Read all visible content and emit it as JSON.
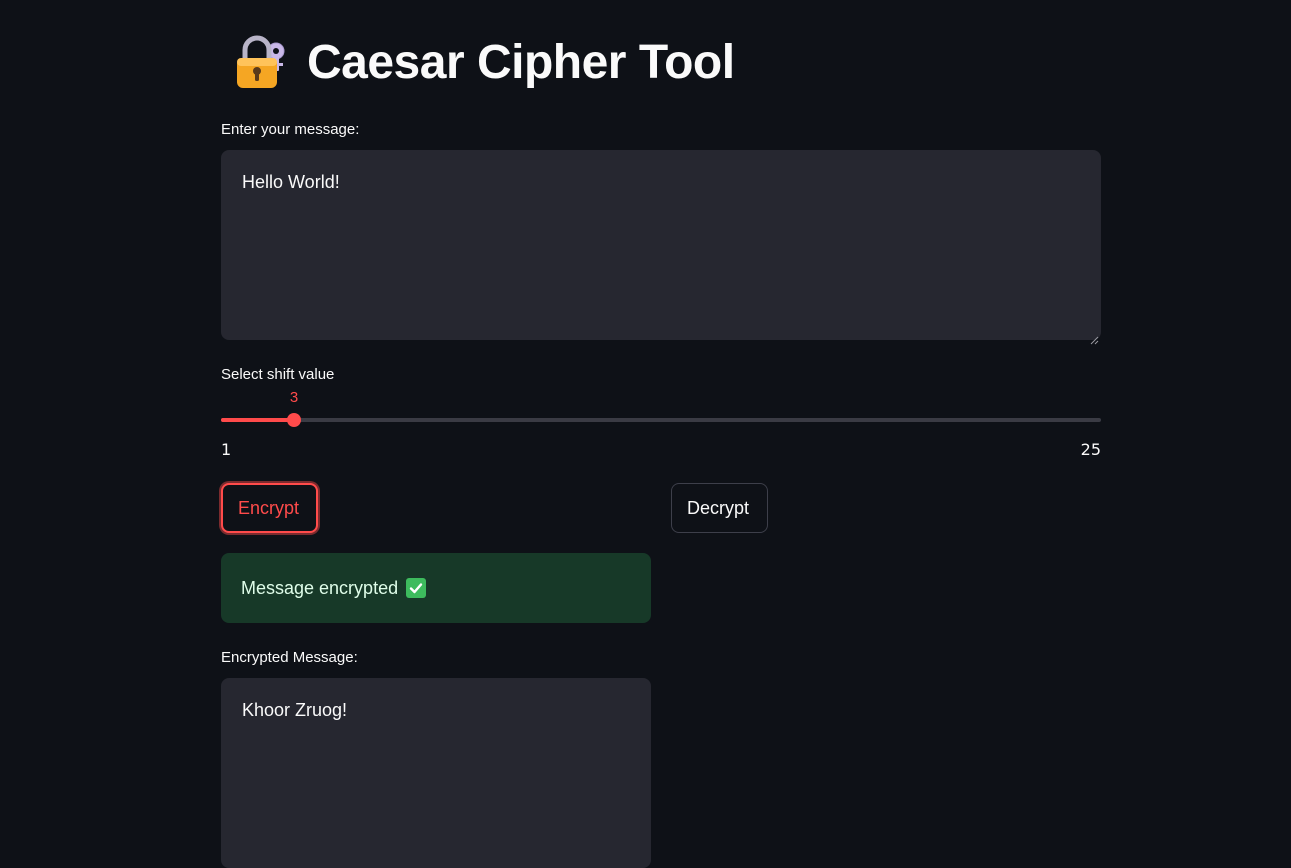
{
  "header": {
    "title": "Caesar Cipher Tool",
    "icon": "lock-with-key-icon"
  },
  "input": {
    "label": "Enter your message:",
    "value": "Hello World!"
  },
  "slider": {
    "label": "Select shift value",
    "value": 3,
    "min": 1,
    "max": 25,
    "min_label": "1",
    "max_label": "25",
    "value_label": "3",
    "accent_color": "#ff4b4b"
  },
  "buttons": {
    "encrypt_label": "Encrypt",
    "decrypt_label": "Decrypt"
  },
  "status": {
    "message": "Message encrypted",
    "icon": "check-mark-icon",
    "color": "#173928"
  },
  "output": {
    "label": "Encrypted Message:",
    "value": "Khoor Zruog!"
  },
  "colors": {
    "background": "#0e1117",
    "field": "#262730",
    "primary": "#ff4b4b"
  }
}
